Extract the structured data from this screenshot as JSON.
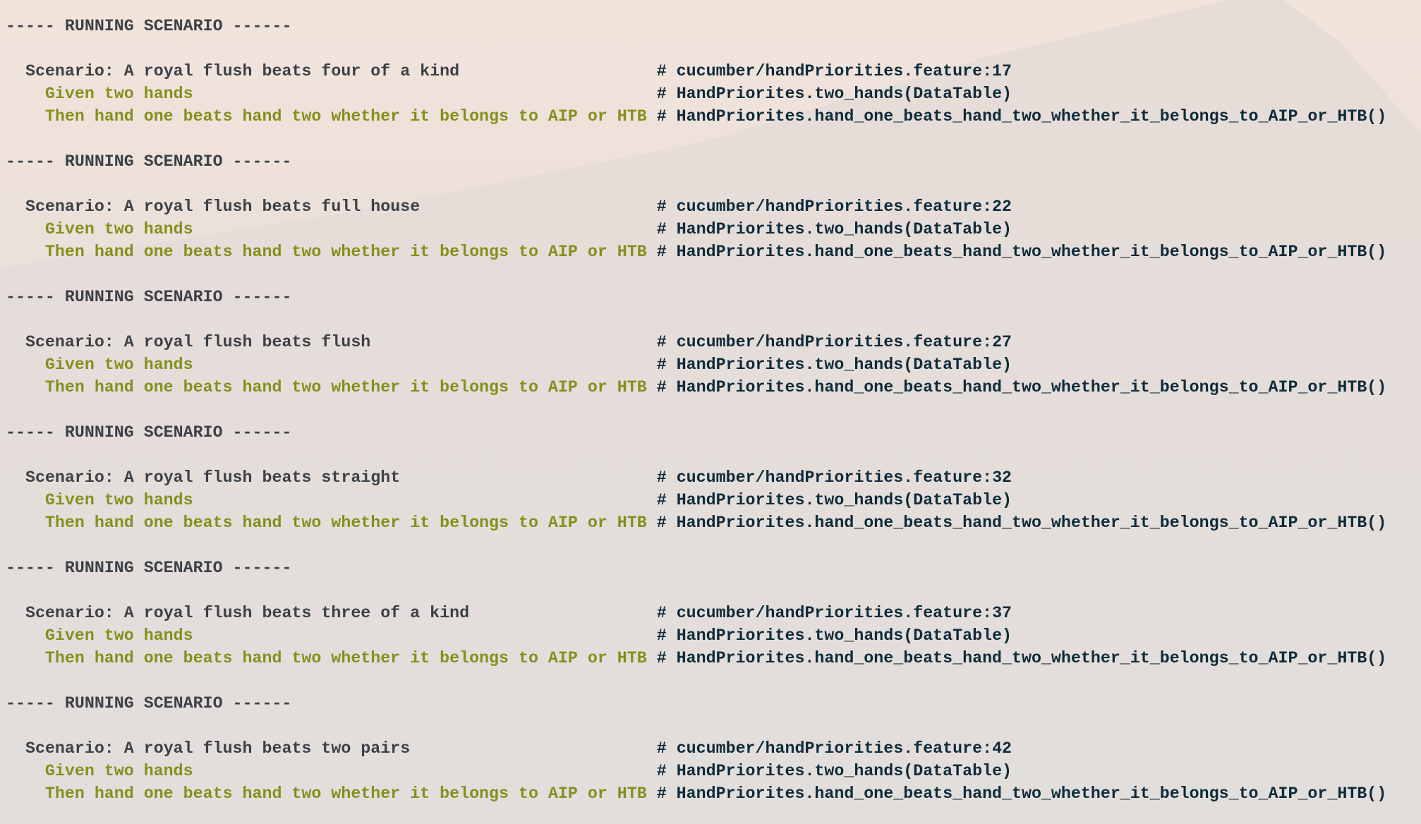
{
  "heading": "----- RUNNING SCENARIO ------",
  "colors": {
    "text": "#3c4146",
    "step": "#84901c",
    "comment": "#0e2b3a"
  },
  "scenarios": [
    {
      "title": "Scenario: A royal flush beats four of a kind",
      "location": "# cucumber/handPriorities.feature:17",
      "given": "Given two hands",
      "given_ref": "# HandPriorites.two_hands(DataTable)",
      "then": "Then hand one beats hand two whether it belongs to AIP or HTB",
      "then_ref": "# HandPriorites.hand_one_beats_hand_two_whether_it_belongs_to_AIP_or_HTB()"
    },
    {
      "title": "Scenario: A royal flush beats full house",
      "location": "# cucumber/handPriorities.feature:22",
      "given": "Given two hands",
      "given_ref": "# HandPriorites.two_hands(DataTable)",
      "then": "Then hand one beats hand two whether it belongs to AIP or HTB",
      "then_ref": "# HandPriorites.hand_one_beats_hand_two_whether_it_belongs_to_AIP_or_HTB()"
    },
    {
      "title": "Scenario: A royal flush beats flush",
      "location": "# cucumber/handPriorities.feature:27",
      "given": "Given two hands",
      "given_ref": "# HandPriorites.two_hands(DataTable)",
      "then": "Then hand one beats hand two whether it belongs to AIP or HTB",
      "then_ref": "# HandPriorites.hand_one_beats_hand_two_whether_it_belongs_to_AIP_or_HTB()"
    },
    {
      "title": "Scenario: A royal flush beats straight",
      "location": "# cucumber/handPriorities.feature:32",
      "given": "Given two hands",
      "given_ref": "# HandPriorites.two_hands(DataTable)",
      "then": "Then hand one beats hand two whether it belongs to AIP or HTB",
      "then_ref": "# HandPriorites.hand_one_beats_hand_two_whether_it_belongs_to_AIP_or_HTB()"
    },
    {
      "title": "Scenario: A royal flush beats three of a kind",
      "location": "# cucumber/handPriorities.feature:37",
      "given": "Given two hands",
      "given_ref": "# HandPriorites.two_hands(DataTable)",
      "then": "Then hand one beats hand two whether it belongs to AIP or HTB",
      "then_ref": "# HandPriorites.hand_one_beats_hand_two_whether_it_belongs_to_AIP_or_HTB()"
    },
    {
      "title": "Scenario: A royal flush beats two pairs",
      "location": "# cucumber/handPriorities.feature:42",
      "given": "Given two hands",
      "given_ref": "# HandPriorites.two_hands(DataTable)",
      "then": "Then hand one beats hand two whether it belongs to AIP or HTB",
      "then_ref": "# HandPriorites.hand_one_beats_hand_two_whether_it_belongs_to_AIP_or_HTB()"
    }
  ]
}
